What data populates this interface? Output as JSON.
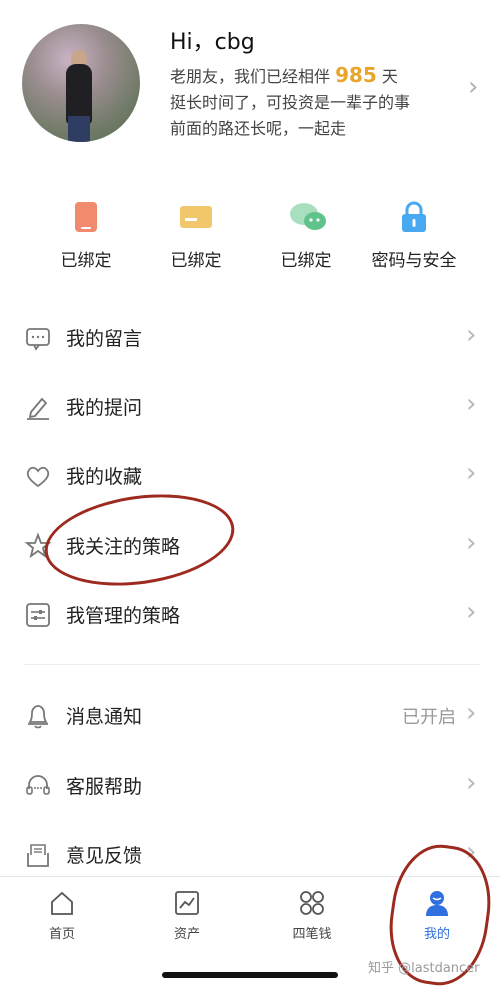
{
  "profile": {
    "greeting": "Hi，cbg",
    "bio_prefix": "老朋友，我们已经相伴 ",
    "days": "985",
    "bio_suffix": " 天",
    "bio_line2": "挺长时间了，可投资是一辈子的事",
    "bio_line3": "前面的路还长呢，一起走"
  },
  "quick_actions": [
    {
      "label": "已绑定",
      "icon": "phone-icon",
      "color": "#f08b6f"
    },
    {
      "label": "已绑定",
      "icon": "bank-card-icon",
      "color": "#f2c76b"
    },
    {
      "label": "已绑定",
      "icon": "wechat-icon",
      "color": "#7fd1a4"
    },
    {
      "label": "密码与安全",
      "icon": "lock-icon",
      "color": "#48a8f0"
    }
  ],
  "menu": [
    {
      "label": "我的留言",
      "icon": "message-icon"
    },
    {
      "label": "我的提问",
      "icon": "edit-icon"
    },
    {
      "label": "我的收藏",
      "icon": "heart-icon"
    },
    {
      "label": "我关注的策略",
      "icon": "star-icon"
    },
    {
      "label": "我管理的策略",
      "icon": "sliders-icon"
    }
  ],
  "settings": [
    {
      "label": "消息通知",
      "icon": "bell-icon",
      "value": "已开启"
    },
    {
      "label": "客服帮助",
      "icon": "headset-icon",
      "value": ""
    },
    {
      "label": "意见反馈",
      "icon": "feedback-icon",
      "value": ""
    }
  ],
  "tabs": [
    {
      "label": "首页",
      "icon": "home-icon"
    },
    {
      "label": "资产",
      "icon": "chart-icon"
    },
    {
      "label": "四笔钱",
      "icon": "grid-icon"
    },
    {
      "label": "我的",
      "icon": "user-icon",
      "active": true
    }
  ],
  "watermark": "知乎 @lastdancer",
  "colors": {
    "accent_gold": "#e8a52a",
    "tab_active": "#2f6fe0",
    "annotation": "#9c2a1f"
  }
}
